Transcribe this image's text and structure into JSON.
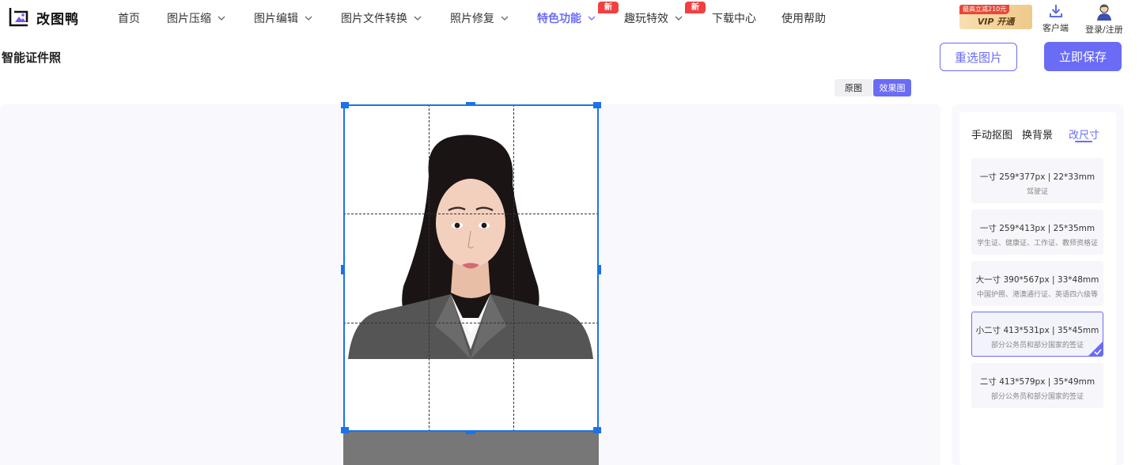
{
  "app": {
    "name": "改图鸭"
  },
  "nav": {
    "items": [
      {
        "label": "首页",
        "dropdown": false
      },
      {
        "label": "图片压缩",
        "dropdown": true
      },
      {
        "label": "图片编辑",
        "dropdown": true
      },
      {
        "label": "图片文件转换",
        "dropdown": true
      },
      {
        "label": "照片修复",
        "dropdown": true
      },
      {
        "label": "特色功能",
        "dropdown": true,
        "active": true,
        "badge": "新"
      },
      {
        "label": "趣玩特效",
        "dropdown": true,
        "badge": "新"
      },
      {
        "label": "下载中心",
        "dropdown": false
      },
      {
        "label": "使用帮助",
        "dropdown": false
      }
    ]
  },
  "vip": {
    "promo": "最高立减210元",
    "label": "VIP 开通"
  },
  "client": {
    "label": "客户端",
    "icon": "download-icon"
  },
  "account": {
    "label": "登录/注册",
    "icon": "avatar"
  },
  "page": {
    "title": "智能证件照"
  },
  "actions": {
    "reselect": "重选图片",
    "save": "立即保存"
  },
  "view_toggle": {
    "original": "原图",
    "effect": "效果图",
    "selected": "效果图"
  },
  "panel": {
    "tabs": [
      {
        "label": "手动抠图"
      },
      {
        "label": "换背景"
      },
      {
        "label": "改尺寸",
        "active": true
      }
    ],
    "sizes": [
      {
        "title": "一寸 259*377px | 22*33mm",
        "desc": "驾驶证",
        "selected": false
      },
      {
        "title": "一寸 259*413px | 25*35mm",
        "desc": "学生证、健康证、工作证、教师资格证",
        "selected": false
      },
      {
        "title": "大一寸 390*567px | 33*48mm",
        "desc": "中国护照、港澳通行证、英语四六级等",
        "selected": false
      },
      {
        "title": "小二寸 413*531px | 35*45mm",
        "desc": "部分公务员和部分国家的签证",
        "selected": true
      },
      {
        "title": "二寸 413*579px | 35*49mm",
        "desc": "部分公务员和部分国家的签证",
        "selected": false
      }
    ]
  },
  "colors": {
    "accent": "#6a6cf6",
    "crop": "#1a73e8",
    "badge": "#f04040"
  }
}
